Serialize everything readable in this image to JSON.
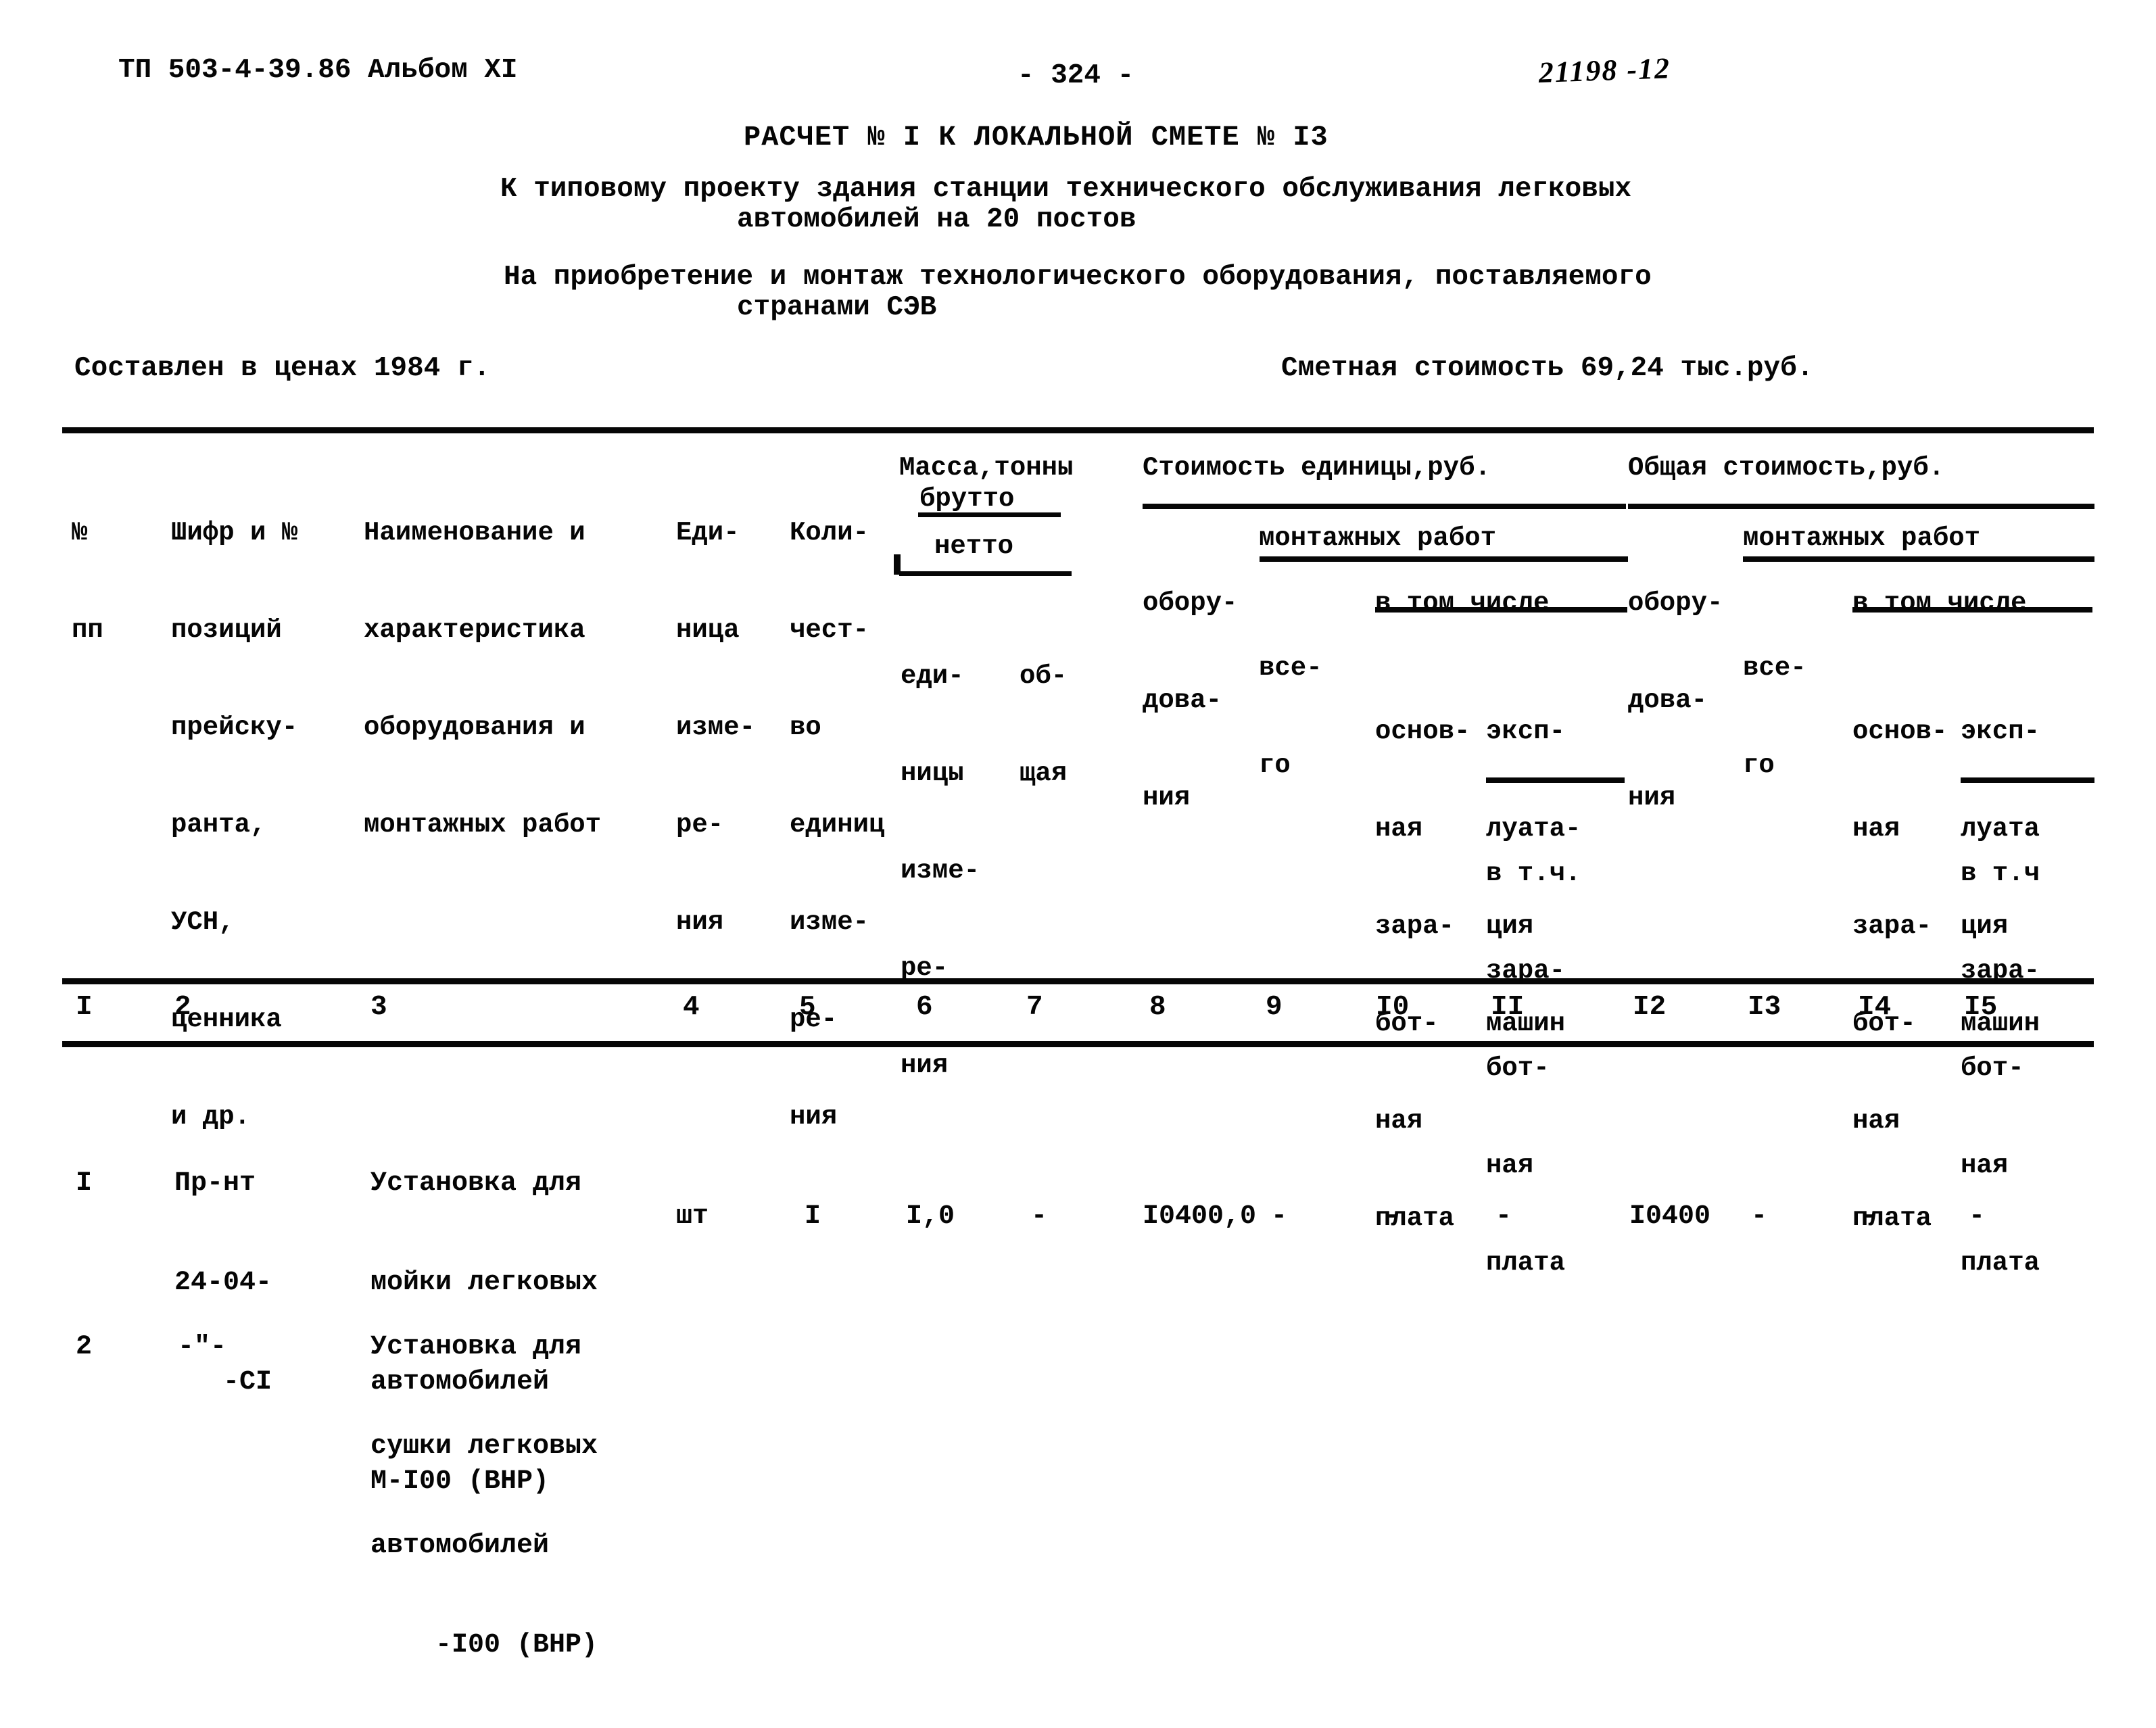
{
  "header": {
    "doc_code": "ТП 503-4-39.86 Альбом XI",
    "page_number": "- 324 -",
    "handwritten_code": "21198 -12"
  },
  "title": {
    "main": "РАСЧЕТ № I К ЛОКАЛЬНОЙ СМЕТЕ № I3",
    "sub1_line1": "К типовому проекту здания станции технического обслуживания легковых",
    "sub1_line2": "автомобилей на 20 постов",
    "sub2_line1": "На приобретение и монтаж технологического оборудования, поставляемого",
    "sub2_line2": "странами СЭВ"
  },
  "meta": {
    "prices_year": "Составлен в ценах 1984 г.",
    "total_cost": "Сметная стоимость 69,24 тыс.руб."
  },
  "table": {
    "headers": {
      "col1_l1": "№",
      "col1_l2": "пп",
      "col2_l1": "Шифр и №",
      "col2_l2": "позиций",
      "col2_l3": "прейску-",
      "col2_l4": "ранта,",
      "col2_l5": "УСН,",
      "col2_l6": "ценника",
      "col2_l7": "и др.",
      "col3_l1": "Наименование и",
      "col3_l2": "характеристика",
      "col3_l3": "оборудования и",
      "col3_l4": "монтажных работ",
      "col4_l1": "Еди-",
      "col4_l2": "ница",
      "col4_l3": "изме-",
      "col4_l4": "ре-",
      "col4_l5": "ния",
      "col5_l1": "Коли-",
      "col5_l2": "чест-",
      "col5_l3": "во",
      "col5_l4": "единиц",
      "col5_l5": "изме-",
      "col5_l6": "ре-",
      "col5_l7": "ния",
      "mass_title": "Масса,тонны",
      "mass_brutto": "брутто",
      "mass_netto": "нетто",
      "col6_l1": "еди-",
      "col6_l2": "ницы",
      "col6_l3": "изме-",
      "col6_l4": "ре-",
      "col6_l5": "ния",
      "col7_l1": "об-",
      "col7_l2": "щая",
      "unit_cost_title": "Стоимость единицы,руб.",
      "total_cost_title": "Общая стоимость,руб.",
      "equip_l1": "обору-",
      "equip_l2": "дова-",
      "equip_l3": "ния",
      "montage_works": "монтажных работ",
      "vsego_l1": "все-",
      "vsego_l2": "го",
      "v_tom_chisle": "в том числе",
      "osn_l1": "основ-",
      "osn_l2": "ная",
      "osn_l3": "зара-",
      "osn_l4": "бот-",
      "osn_l5": "ная",
      "osn_l6": "плата",
      "eksp_l1": "эксп-",
      "eksp_l2": "луата-",
      "eksp_l3": "ция",
      "eksp_l4": "машин",
      "vtch_l1": "в т.ч.",
      "vtch_l2": "зара-",
      "vtch_l3": "бот-",
      "vtch_l4": "ная",
      "vtch_l5": "плата",
      "eksp2_l1": "эксп-",
      "eksp2_l2": "луата",
      "eksp2_l3": "ция",
      "eksp2_l4": "машин",
      "vtch2_l1": "в т.ч",
      "vtch2_l2": "зара-",
      "vtch2_l3": "бот-",
      "vtch2_l4": "ная",
      "vtch2_l5": "плата"
    },
    "column_numbers": [
      "I",
      "2",
      "3",
      "4",
      "5",
      "6",
      "7",
      "8",
      "9",
      "I0",
      "II",
      "I2",
      "I3",
      "I4",
      "I5"
    ],
    "rows": [
      {
        "num": "I",
        "code_l1": "Пр-нт",
        "code_l2": "24-04-",
        "code_l3": "-CI",
        "name_l1": "Установка для",
        "name_l2": "мойки легковых",
        "name_l3": "автомобилей",
        "name_l4": "М-I00 (ВНР)",
        "unit": "шт",
        "qty": "I",
        "mass_unit": "I,0",
        "mass_total": "-",
        "equip_unit": "I0400,0",
        "mont_vsego": "-",
        "mont_osn": "-",
        "mont_eksp": "-",
        "equip_total": "I0400",
        "tot_vsego": "-",
        "tot_osn": "-",
        "tot_eksp": "-"
      },
      {
        "num": "2",
        "code_l1": "-\"-",
        "code_l2": "",
        "code_l3": "",
        "name_l1": "Установка для",
        "name_l2": "сушки легковых",
        "name_l3": "автомобилей",
        "name_l4": "-I00 (ВНР)",
        "unit": "",
        "qty": "",
        "mass_unit": "",
        "mass_total": "",
        "equip_unit": "",
        "mont_vsego": "",
        "mont_osn": "",
        "mont_eksp": "",
        "equip_total": "",
        "tot_vsego": "",
        "tot_osn": "",
        "tot_eksp": ""
      }
    ]
  }
}
